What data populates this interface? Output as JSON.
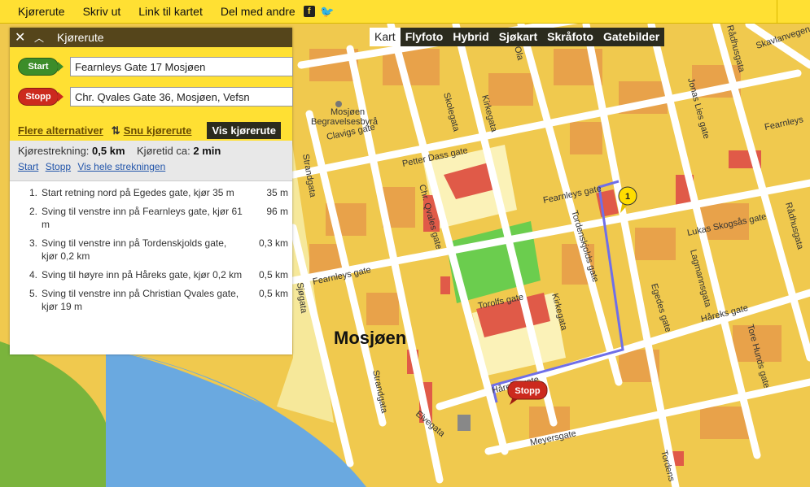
{
  "topbar": {
    "items": [
      "Kjørerute",
      "Skriv ut",
      "Link til kartet",
      "Del med andre"
    ],
    "facebook_icon": "facebook-icon",
    "twitter_icon": "twitter-icon"
  },
  "map_types": [
    "Kart",
    "Flyfoto",
    "Hybrid",
    "Sjøkart",
    "Skråfoto",
    "Gatebilder"
  ],
  "panel": {
    "title": "Kjørerute",
    "start_label": "Start",
    "start_value": "Fearnleys Gate 17 Mosjøen",
    "stop_label": "Stopp",
    "stop_value": "Chr. Qvales Gate 36, Mosjøen, Vefsn",
    "more_options": "Flere alternativer",
    "reverse": "Snu kjørerute",
    "show_route": "Vis kjørerute",
    "distance_label": "Kjørestrekning:",
    "distance_value": "0,5 km",
    "time_label": "Kjøretid ca:",
    "time_value": "2 min",
    "link_start": "Start",
    "link_stop": "Stopp",
    "link_all": "Vis hele strekningen",
    "steps": [
      {
        "num": "1.",
        "text": "Start retning nord på Egedes gate, kjør 35 m",
        "dist": "35 m"
      },
      {
        "num": "2.",
        "text": "Sving til venstre inn på Fearnleys gate, kjør 61 m",
        "dist": "96 m"
      },
      {
        "num": "3.",
        "text": "Sving til venstre inn på Tordenskjolds gate, kjør 0,2 km",
        "dist": "0,3 km"
      },
      {
        "num": "4.",
        "text": "Sving til høyre inn på Håreks gate, kjør 0,2 km",
        "dist": "0,5 km"
      },
      {
        "num": "5.",
        "text": "Sving til venstre inn på Christian Qvales gate, kjør 19 m",
        "dist": "0,5 km"
      }
    ]
  },
  "map": {
    "town": "Mosjøen",
    "poi": [
      "Mosjøen",
      "Begravelsesbyrå"
    ],
    "marker_1": "1",
    "marker_stop": "Stopp",
    "streets": {
      "fearnleys_a": "Fearnleys gate",
      "fearnleys_b": "Fearnleys gate",
      "fearnleys_c": "Fearnleys",
      "petter_dass": "Petter Dass gate",
      "skolegata": "Skolegata",
      "kirkegata_a": "Kirkegata",
      "kirkegata_b": "Kirkegata",
      "chr_qvales": "Chr. Qvales gate",
      "strandgata_a": "Strandgata",
      "strandgata_b": "Strandgata",
      "sjogata": "Sjøgata",
      "torolfs": "Torolfs gate",
      "tordenskjolds": "Tordenskjolds gate",
      "egedes": "Egedes gate",
      "lukas": "Lukas Skogsås gate",
      "lagmanns": "Lagmannsgata",
      "hareks_a": "Håreks gate",
      "hareks_b": "Håreks gate",
      "tore": "Tore Hunds gate",
      "radhus_a": "Rådhusgata",
      "radhus_b": "Rådhusgata",
      "skavlan": "Skavlanvegen",
      "jonas": "Jonas Lies gate",
      "meyers": "Meyersgate",
      "elvegata": "Elvegata",
      "clavigs": "Clavigs gate",
      "tordens": "Tordens",
      "ola": "Ola"
    }
  }
}
